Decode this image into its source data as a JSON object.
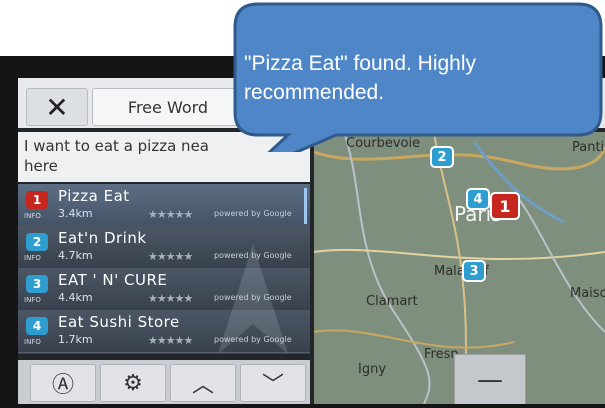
{
  "topbar": {
    "close_label": "✕",
    "mode_label": "Free Word"
  },
  "query": {
    "text": "I want to eat a pizza nea\nhere"
  },
  "results": [
    {
      "index": "1",
      "name": "Pizza Eat",
      "distance": "3.4km",
      "stars": "★★★★★",
      "powered": "powered by Google",
      "info": "INFO",
      "color": "#c7261f"
    },
    {
      "index": "2",
      "name": "Eat'n Drink",
      "distance": "4.7km",
      "stars": "★★★★★",
      "powered": "powered by Google",
      "info": "INFO",
      "color": "#2e9dd0"
    },
    {
      "index": "3",
      "name": "EAT ' N' CURE",
      "distance": "4.4km",
      "stars": "★★★★★",
      "powered": "powered by Google",
      "info": "INFO",
      "color": "#2e9dd0"
    },
    {
      "index": "4",
      "name": "Eat Sushi Store",
      "distance": "1.7km",
      "stars": "★★★★★",
      "powered": "powered by Google",
      "info": "INFO",
      "color": "#2e9dd0"
    }
  ],
  "toolbar": {
    "nav_icon": "Ⓐ",
    "settings_icon": "⚙",
    "up_icon": "︿",
    "down_icon": "﹀"
  },
  "map": {
    "labels": [
      "Courbevoie",
      "Paris",
      "Malakoff",
      "Clamart",
      "Fresn",
      "Igny",
      "Panti",
      "Maiso"
    ],
    "zoom_out": "—"
  },
  "callout": {
    "line1": "\"Pizza Eat\" found. Highly",
    "line2": "recommended."
  },
  "colors": {
    "callout_fill": "#4e86c7",
    "callout_border": "#2f5a8c",
    "selected_marker": "#c7261f",
    "other_marker": "#2e9dd0"
  }
}
